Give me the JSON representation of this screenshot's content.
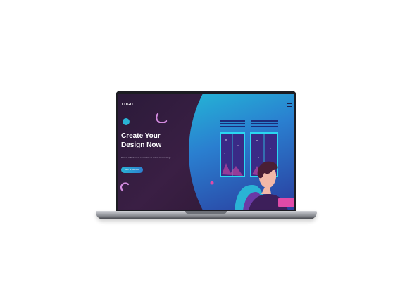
{
  "page": {
    "logo": "LOGO",
    "headline_line1": "Create Your",
    "headline_line2": "Design Now",
    "subtext": "Pernum et Tanlenatum ex complets un endum amm ex Ilnege",
    "cta_label": "GET STARTED"
  },
  "colors": {
    "screen_bg": "#2b1a39",
    "blob_start": "#24b4d6",
    "blob_end": "#2a3d9e",
    "accent_pink": "#e04aa8",
    "accent_cyan": "#2ab3d5"
  },
  "icons": {
    "menu": "hamburger-menu-icon"
  }
}
